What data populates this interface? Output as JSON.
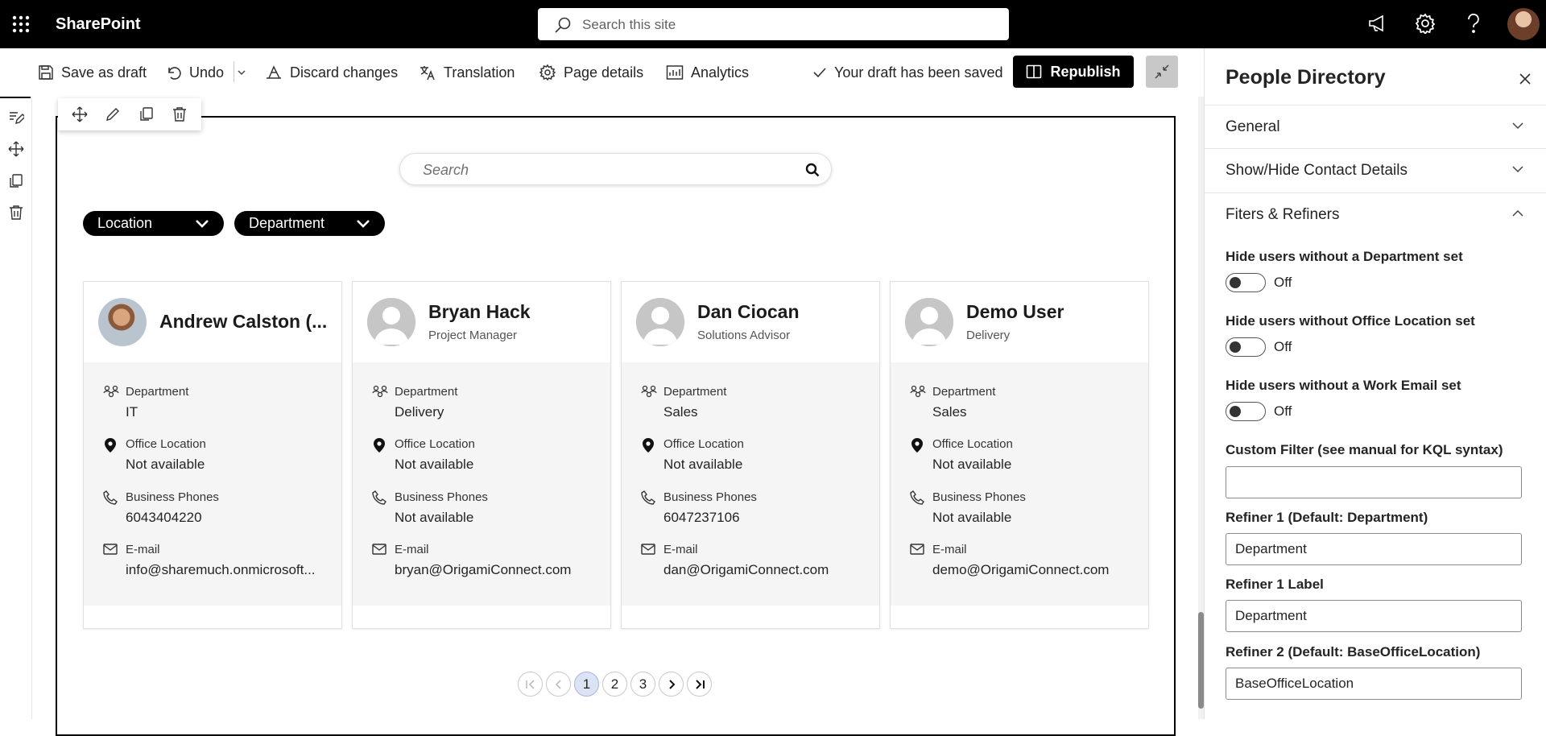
{
  "suite": {
    "brand": "SharePoint",
    "search_placeholder": "Search this site"
  },
  "commands": {
    "save_draft": "Save as draft",
    "undo": "Undo",
    "discard": "Discard changes",
    "translation": "Translation",
    "page_details": "Page details",
    "analytics": "Analytics",
    "status": "Your draft has been saved",
    "republish": "Republish"
  },
  "directory": {
    "search_placeholder": "Search",
    "filters": [
      {
        "label": "Location"
      },
      {
        "label": "Department"
      }
    ],
    "field_labels": {
      "department": "Department",
      "office": "Office Location",
      "phones": "Business Phones",
      "email": "E-mail"
    },
    "people": [
      {
        "name": "Andrew Calston (...",
        "title": "",
        "department": "IT",
        "office": "Not available",
        "phone": "6043404220",
        "email": "info@sharemuch.onmicrosoft..."
      },
      {
        "name": "Bryan Hack",
        "title": "Project Manager",
        "department": "Delivery",
        "office": "Not available",
        "phone": "Not available",
        "email": "bryan@OrigamiConnect.com"
      },
      {
        "name": "Dan Ciocan",
        "title": "Solutions Advisor",
        "department": "Sales",
        "office": "Not available",
        "phone": "6047237106",
        "email": "dan@OrigamiConnect.com"
      },
      {
        "name": "Demo User",
        "title": "Delivery",
        "department": "Sales",
        "office": "Not available",
        "phone": "Not available",
        "email": "demo@OrigamiConnect.com"
      }
    ],
    "pagination": {
      "pages": [
        "1",
        "2",
        "3"
      ],
      "current": "1"
    }
  },
  "panel": {
    "title": "People Directory",
    "sections": {
      "general": "General",
      "contact": "Show/Hide Contact Details",
      "filters": "Fiters & Refiners"
    },
    "toggles": [
      {
        "label": "Hide users without a Department set",
        "state": "Off"
      },
      {
        "label": "Hide users without Office Location set",
        "state": "Off"
      },
      {
        "label": "Hide users without a Work Email set",
        "state": "Off"
      }
    ],
    "custom_filter_label": "Custom Filter (see manual for KQL syntax)",
    "custom_filter_value": "",
    "refiner1_label": "Refiner 1 (Default: Department)",
    "refiner1_value": "Department",
    "refiner1_label_label": "Refiner 1 Label",
    "refiner1_label_value": "Department",
    "refiner2_label": "Refiner 2 (Default: BaseOfficeLocation)",
    "refiner2_value": "BaseOfficeLocation"
  }
}
